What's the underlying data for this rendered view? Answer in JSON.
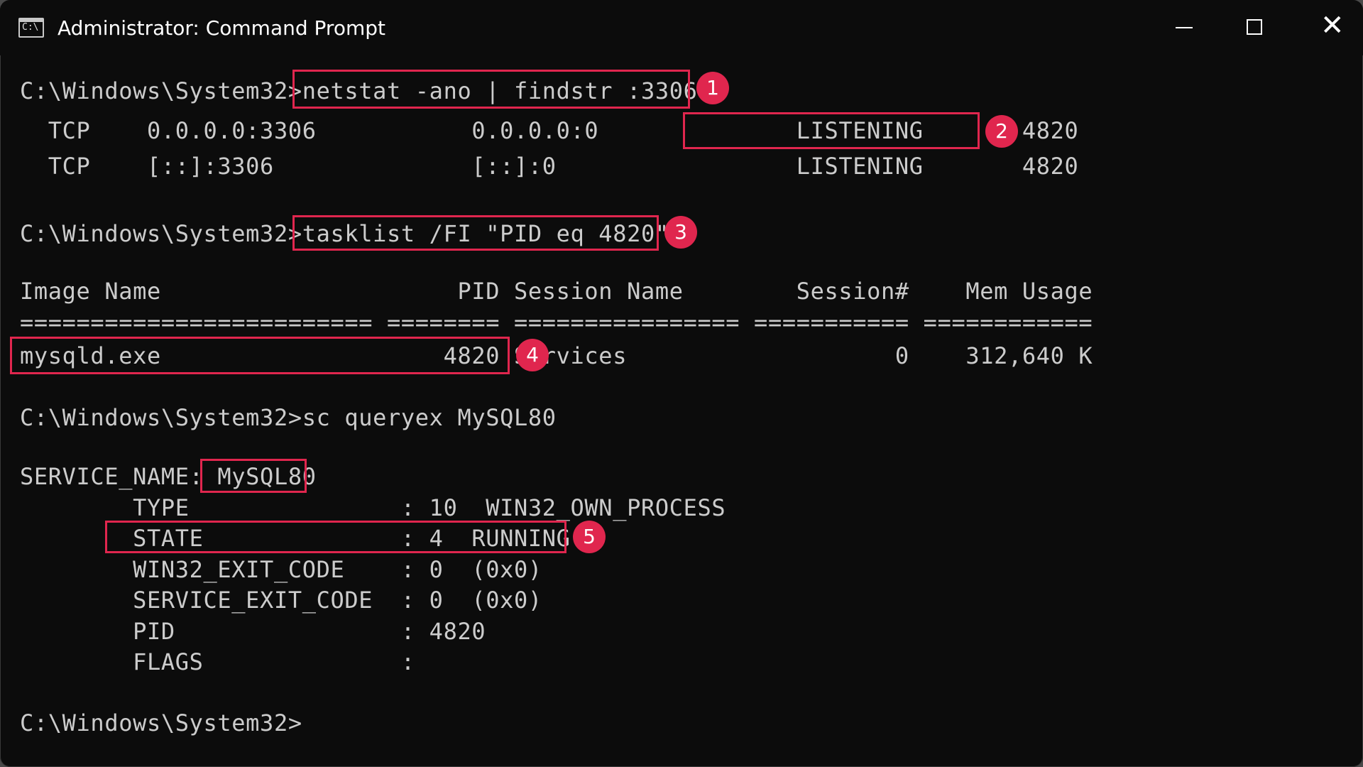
{
  "window": {
    "title": "Administrator: Command Prompt",
    "icon_text": "C:\\",
    "minimize": "minimize",
    "maximize": "maximize",
    "close_glyph": "✕"
  },
  "terminal": {
    "lines": [
      "C:\\Windows\\System32>netstat -ano | findstr :3306",
      "  TCP    0.0.0.0:3306           0.0.0.0:0              LISTENING       4820",
      "  TCP    [::]:3306              [::]:0                 LISTENING       4820",
      "C:\\Windows\\System32>tasklist /FI \"PID eq 4820\"",
      "Image Name                     PID Session Name        Session#    Mem Usage",
      "========================= ======== ================ =========== ============",
      "mysqld.exe                    4820 Services                   0    312,640 K",
      "C:\\Windows\\System32>sc queryex MySQL80",
      "SERVICE_NAME: MySQL80",
      "        TYPE               : 10  WIN32_OWN_PROCESS",
      "        STATE              : 4  RUNNING",
      "        WIN32_EXIT_CODE    : 0  (0x0)",
      "        SERVICE_EXIT_CODE  : 0  (0x0)",
      "        PID                : 4820",
      "        FLAGS              :",
      "C:\\Windows\\System32>"
    ]
  },
  "callouts": [
    "1",
    "2",
    "3",
    "4",
    "5"
  ],
  "colors": {
    "background": "#0c0c0c",
    "text": "#cccccc",
    "highlight": "#e0264e"
  }
}
